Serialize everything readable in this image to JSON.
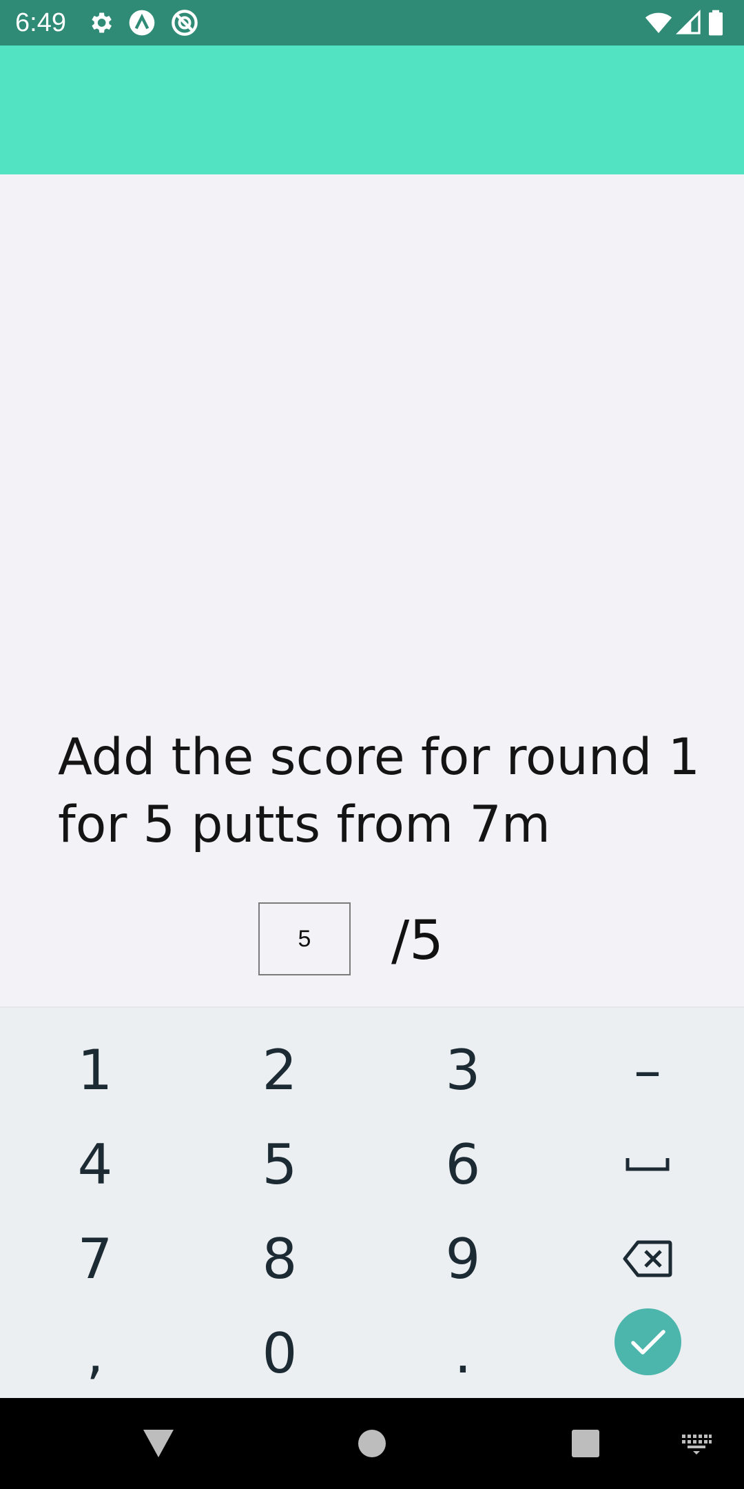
{
  "status_bar": {
    "time": "6:49",
    "icons": [
      "settings-gear-icon",
      "app-notification-icon",
      "blocked-notification-icon",
      "wifi-icon",
      "cellular-signal-icon",
      "battery-icon"
    ]
  },
  "app_bar": {
    "color": "#52e3c2"
  },
  "prompt": {
    "line1": "Add the score for round 1",
    "line2": "for 5 putts from 7m"
  },
  "score": {
    "value": "5",
    "total": "/5"
  },
  "keyboard": {
    "row1": [
      "1",
      "2",
      "3",
      "–"
    ],
    "row2": [
      "4",
      "5",
      "6"
    ],
    "row3": [
      "7",
      "8",
      "9"
    ],
    "row4": [
      ",",
      "0",
      "."
    ],
    "space_icon": "space-icon",
    "backspace_icon": "backspace-icon",
    "done_icon": "check-icon",
    "accent": "#4db6ac"
  },
  "nav_bar": {
    "icons": [
      "back-triangle-icon",
      "home-circle-icon",
      "recents-square-icon",
      "keyboard-switch-icon"
    ]
  }
}
